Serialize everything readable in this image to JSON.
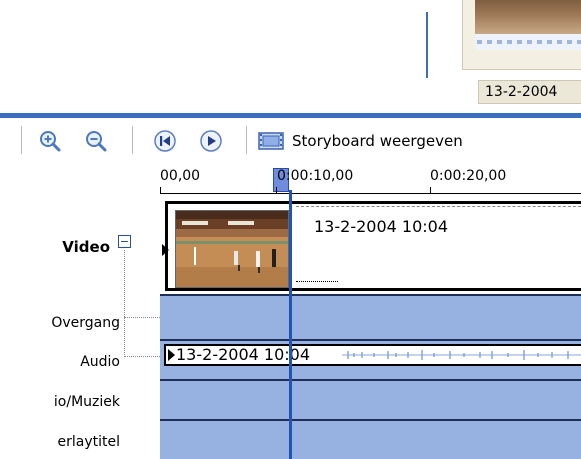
{
  "preview": {
    "thumbnail_caption": "13-2-2004"
  },
  "toolbar": {
    "zoom_in_label": "Zoom in",
    "zoom_out_label": "Zoom out",
    "rewind_label": "Rewind",
    "play_label": "Play",
    "storyboard_label": "Storyboard weergeven"
  },
  "ruler": {
    "ticks": [
      "00,00",
      "0:00:10,00",
      "0:00:20,00"
    ]
  },
  "tracks": {
    "video": "Video",
    "overgang": "Overgang",
    "audio": "Audio",
    "audio_muziek": "io/Muziek",
    "titel": "erlaytitel"
  },
  "clips": {
    "video_title": "13-2-2004 10:04",
    "audio_title": "13-2-2004 10:04"
  },
  "colors": {
    "accent": "#3a6ebe",
    "track_fill": "#97b1e0",
    "playhead": "#2255b2"
  }
}
